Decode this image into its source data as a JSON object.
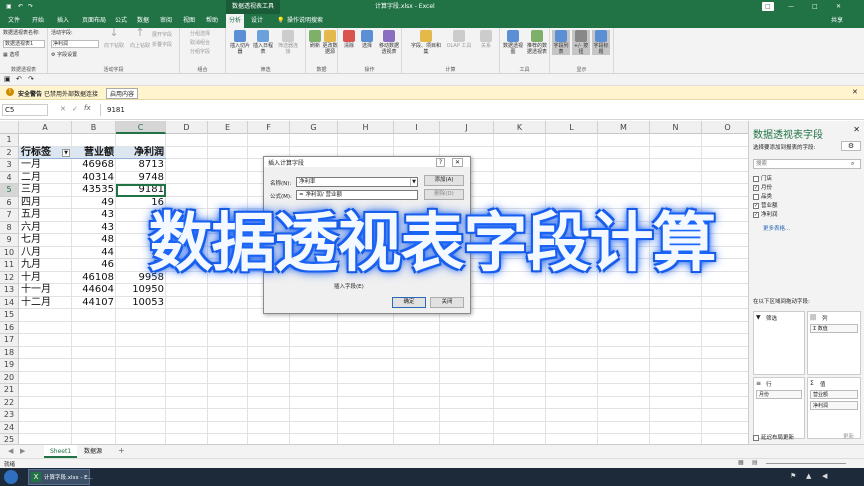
{
  "window": {
    "context_tool": "数据透视表工具",
    "title": "计算字段.xlsx - Excel",
    "window_controls": [
      "□",
      "—",
      "□",
      "✕"
    ]
  },
  "tabs": [
    "文件",
    "开始",
    "插入",
    "页面布局",
    "公式",
    "数据",
    "审阅",
    "视图",
    "帮助",
    "分析",
    "设计"
  ],
  "active_tab": "分析",
  "tell_me": "操作说明搜索",
  "share": "共享",
  "ribbon": {
    "pivot_name_label": "数据透视表名称:",
    "pivot_name": "数据透视表1",
    "options_label": "选项",
    "active_field_label": "活动字段:",
    "active_field": "净利润",
    "field_settings": "字段设置",
    "drill_down": "向下钻取",
    "drill_up": "向上钻取",
    "expand_field": "展开字段",
    "collapse_field": "折叠字段",
    "group_selection": "分组选择",
    "ungroup": "取消组合",
    "group_field": "分组字段",
    "insert_slicer": "插入切片器",
    "insert_timeline": "插入日程表",
    "filter_connections": "筛选器连接",
    "refresh": "刷新",
    "change_source": "更改数据源",
    "clear": "清除",
    "select": "选择",
    "move_pivot": "移动数据透视表",
    "fields_items": "字段、项目和集",
    "olap": "OLAP 工具",
    "relationships": "关系",
    "pivot_chart": "数据透视图",
    "recommended": "推荐的数据透视表",
    "field_list": "字段列表",
    "buttons": "+/- 按钮",
    "field_headers": "字段标题",
    "groups": [
      "数据透视表",
      "活动字段",
      "组合",
      "筛选",
      "数据",
      "操作",
      "计算",
      "工具",
      "显示"
    ]
  },
  "security": {
    "icon": "!",
    "title": "安全警告",
    "message": "已禁用外部数据连接",
    "button": "启用内容"
  },
  "formula_bar": {
    "name_box": "C5",
    "fx": "fx",
    "value": "9181"
  },
  "grid": {
    "columns": [
      "A",
      "B",
      "C",
      "D",
      "E",
      "F",
      "G",
      "H",
      "I",
      "J",
      "K",
      "L",
      "M",
      "N",
      "O"
    ],
    "rows": [
      "1",
      "2",
      "3",
      "4",
      "5",
      "6",
      "7",
      "8",
      "9",
      "10",
      "11",
      "12",
      "13",
      "14",
      "15",
      "16",
      "17",
      "18",
      "19",
      "20",
      "21",
      "22",
      "23",
      "24",
      "25"
    ],
    "selected_col": "C",
    "selected_row": "5",
    "headers": [
      "行标签",
      "营业额",
      "净利润"
    ],
    "data": [
      [
        "一月",
        "46968",
        "8713"
      ],
      [
        "二月",
        "40314",
        "9748"
      ],
      [
        "三月",
        "43535",
        "9181"
      ],
      [
        "四月",
        "49",
        "16"
      ],
      [
        "五月",
        "43",
        ""
      ],
      [
        "六月",
        "43",
        ""
      ],
      [
        "七月",
        "48",
        ""
      ],
      [
        "八月",
        "44",
        "10"
      ],
      [
        "九月",
        "46",
        "46"
      ],
      [
        "十月",
        "46108",
        "9958"
      ],
      [
        "十一月",
        "44604",
        "10950"
      ],
      [
        "十二月",
        "44107",
        "10053"
      ]
    ]
  },
  "dialog": {
    "title": "插入计算字段",
    "help": "?",
    "close": "✕",
    "name_label": "名称(N):",
    "name_value": "净利率",
    "formula_label": "公式(M):",
    "formula_value": "= 净利润/ 营业额",
    "add_button": "添加(A)",
    "delete_button": "删除(D)",
    "insert_field_button": "插入字段(E)",
    "ok_button": "确定",
    "close_button": "关闭"
  },
  "panel": {
    "title": "数据透视表字段",
    "subtitle": "选择要添加到报表的字段:",
    "gear": "⚙",
    "search_placeholder": "搜索",
    "fields": [
      {
        "label": "门店",
        "checked": false
      },
      {
        "label": "月份",
        "checked": true
      },
      {
        "label": "品类",
        "checked": false
      },
      {
        "label": "营业额",
        "checked": true
      },
      {
        "label": "净利润",
        "checked": true
      }
    ],
    "more_tables": "更多表格...",
    "drag_hint": "在以下区域间拖动字段:",
    "filters": "筛选",
    "columns": "列",
    "columns_value": "Σ 数值",
    "rows": "行",
    "rows_value": "月份",
    "values": "值",
    "values_items": [
      "营业额",
      "净利润"
    ],
    "defer_update": "延迟布局更新",
    "update": "更新"
  },
  "sheets": [
    "Sheet1",
    "数据源"
  ],
  "active_sheet": "Sheet1",
  "add_sheet": "+",
  "status": "就绪",
  "overlay_text": "数据透视表字段计算",
  "taskbar": {
    "app_label": "计算字段.xlsx - E..."
  },
  "colors": {
    "excel_green": "#217346",
    "overlay_glow": "#1e6bff",
    "security_bar": "#fff4ce"
  }
}
